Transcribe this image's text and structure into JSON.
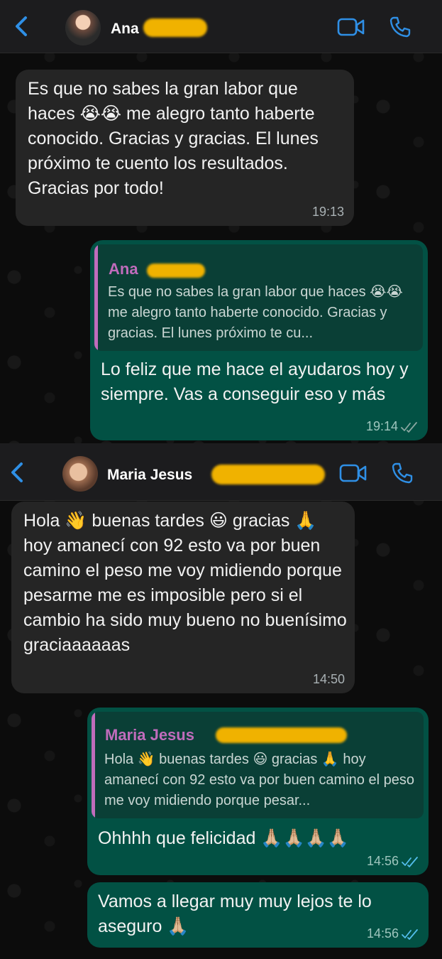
{
  "chat1": {
    "contact_name": "Ana",
    "incoming": {
      "text": "Es que no sabes la gran labor que haces 😭😭 me alegro tanto haberte conocido. Gracias y gracias. El lunes próximo te cuento los resultados. Gracias por todo!",
      "time": "19:13"
    },
    "reply": {
      "quote_name": "Ana",
      "quote_text": "Es que no sabes la gran labor que haces 😭😭 me alegro tanto haberte conocido. Gracias y gracias. El lunes próximo te cu...",
      "text": "Lo feliz que me hace el ayudaros hoy y siempre. Vas a conseguir eso y más",
      "time": "19:14"
    }
  },
  "chat2": {
    "contact_name": "Maria Jesus",
    "incoming": {
      "text": "Hola 👋 buenas tardes 😃 gracias 🙏 hoy amanecí con 92 esto va por buen camino el peso me voy midiendo porque pesarme me es imposible pero si el cambio ha sido muy bueno no buenísimo graciaaaaaas",
      "time": "14:50"
    },
    "reply": {
      "quote_name": "Maria Jesus",
      "quote_text": "Hola 👋 buenas tardes 😃 gracias 🙏 hoy amanecí con 92 esto va por buen camino el peso me voy midiendo porque pesar...",
      "text": "Ohhhh que felicidad 🙏🏼🙏🏼🙏🏼🙏🏼",
      "time": "14:56"
    },
    "outgoing2": {
      "text": "Vamos a llegar muy muy lejos te lo aseguro 🙏🏼",
      "time": "14:56"
    }
  },
  "icons": {
    "back": "chevron-left-icon",
    "video": "video-camera-icon",
    "call": "phone-icon",
    "read": "double-check-icon"
  },
  "colors": {
    "accent": "#2f8fe5",
    "incoming_bubble": "#252525",
    "outgoing_bubble": "#025144",
    "quote_name": "#c06cbc",
    "redaction": "#f0b200"
  }
}
